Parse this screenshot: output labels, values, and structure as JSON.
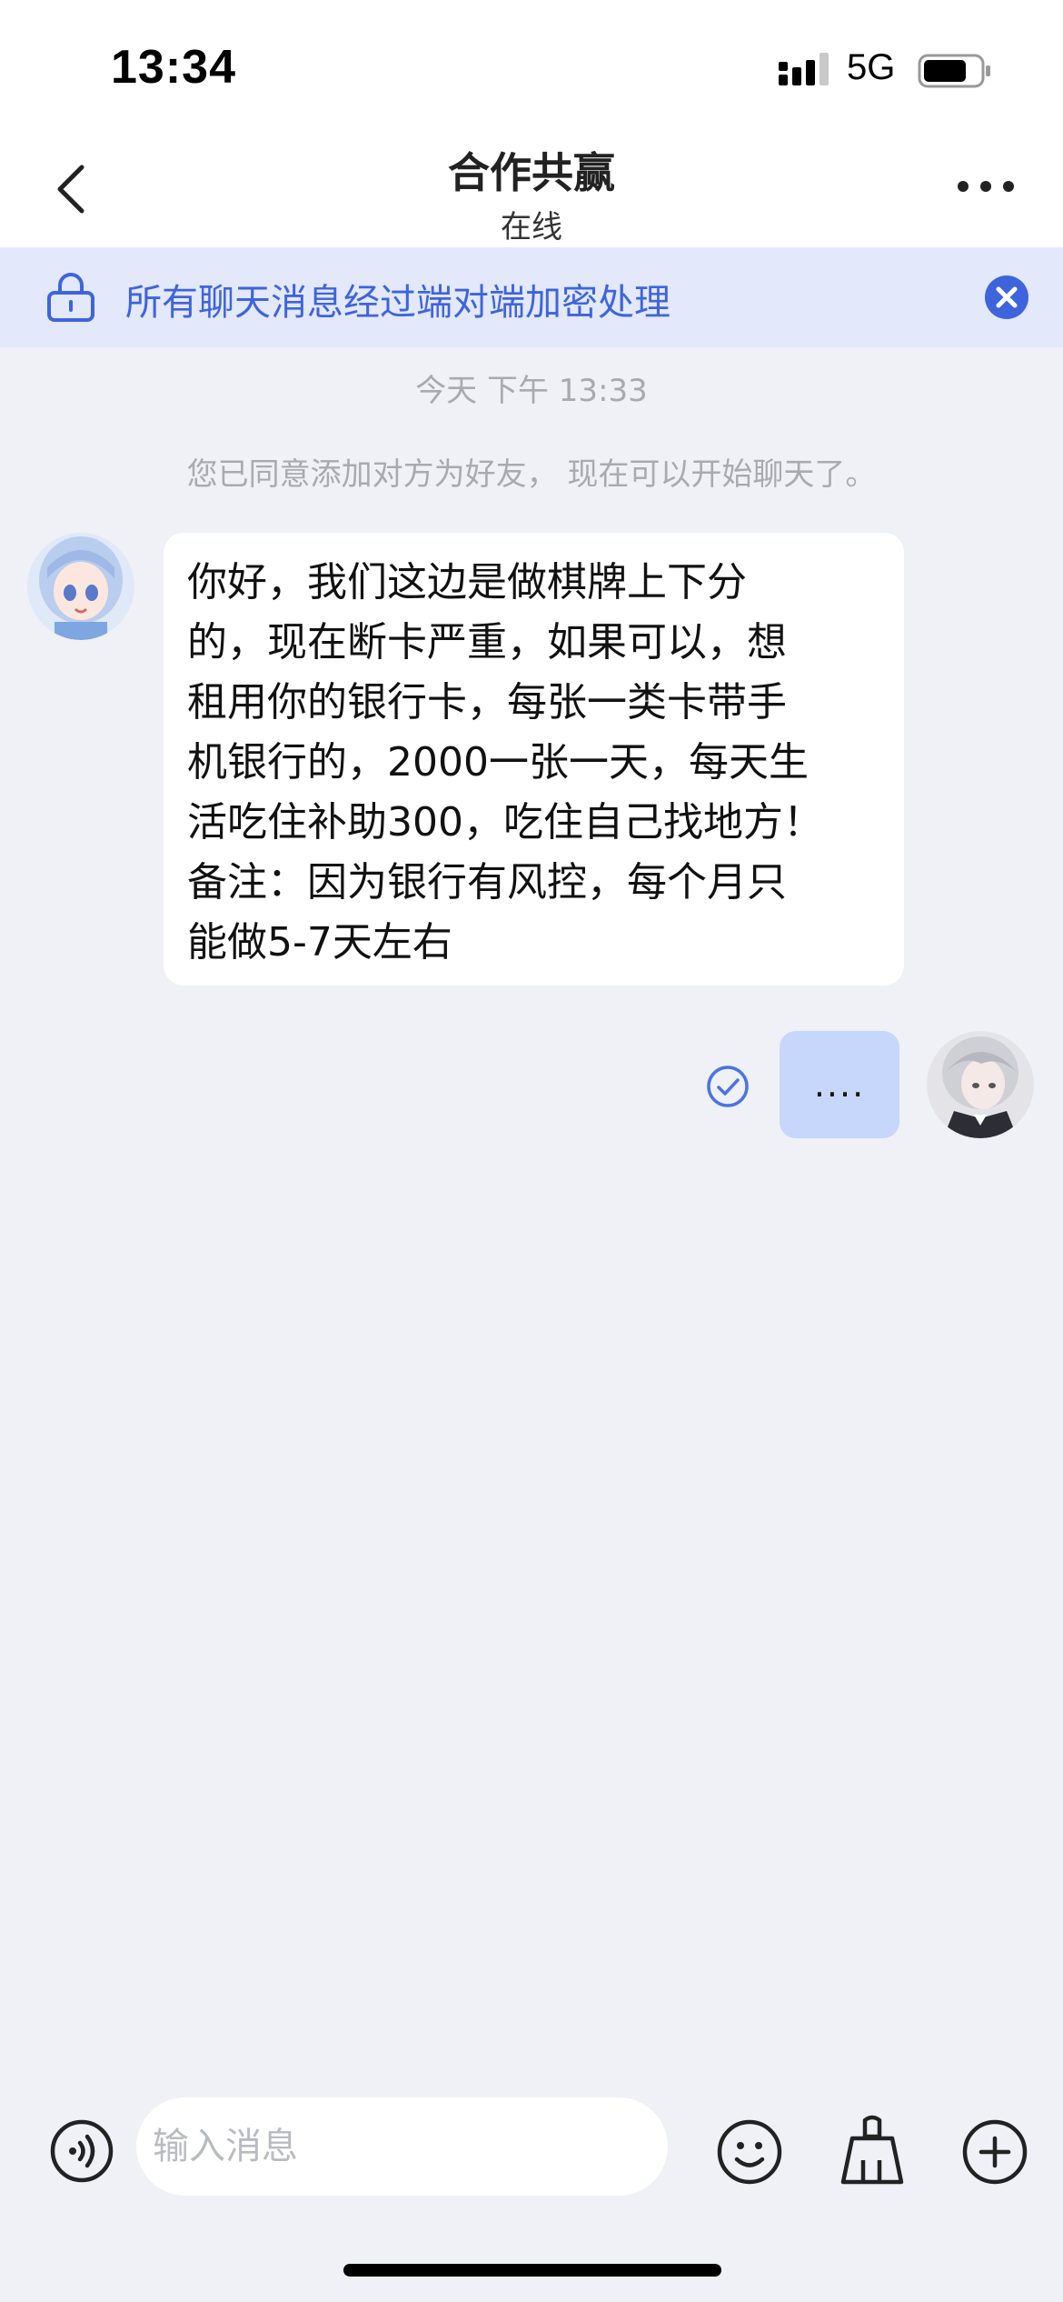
{
  "status_bar": {
    "time": "13:34",
    "network": "5G",
    "icons": [
      "signal-icon",
      "battery-icon"
    ]
  },
  "header": {
    "title": "合作共赢",
    "subtitle": "在线",
    "icons": [
      "back-chevron-icon",
      "more-dots-icon"
    ]
  },
  "banner": {
    "text": "所有聊天消息经过端对端加密处理",
    "accent_color": "#3e64dd",
    "icons": [
      "lock-icon",
      "close-icon"
    ]
  },
  "chat": {
    "timestamp": "今天 下午 13:33",
    "system_message": "您已同意添加对方为好友， 现在可以开始聊天了。",
    "messages": [
      {
        "side": "left",
        "text": "你好，我们这边是做棋牌上下分\n的，现在断卡严重，如果可以，想\n租用你的银行卡，每张一类卡带手\n机银行的，2000一张一天，每天生\n活吃住补助300，吃住自己找地方！\n备注：因为银行有风控，每个月只\n能做5-7天左右"
      },
      {
        "side": "right",
        "text": "....",
        "status_icon": "read-check-icon",
        "bubble_color": "#c6d7fb"
      }
    ]
  },
  "input_bar": {
    "placeholder": "输入消息",
    "icons": [
      "voice-icon",
      "emoji-icon",
      "broom-icon",
      "plus-icon"
    ]
  }
}
